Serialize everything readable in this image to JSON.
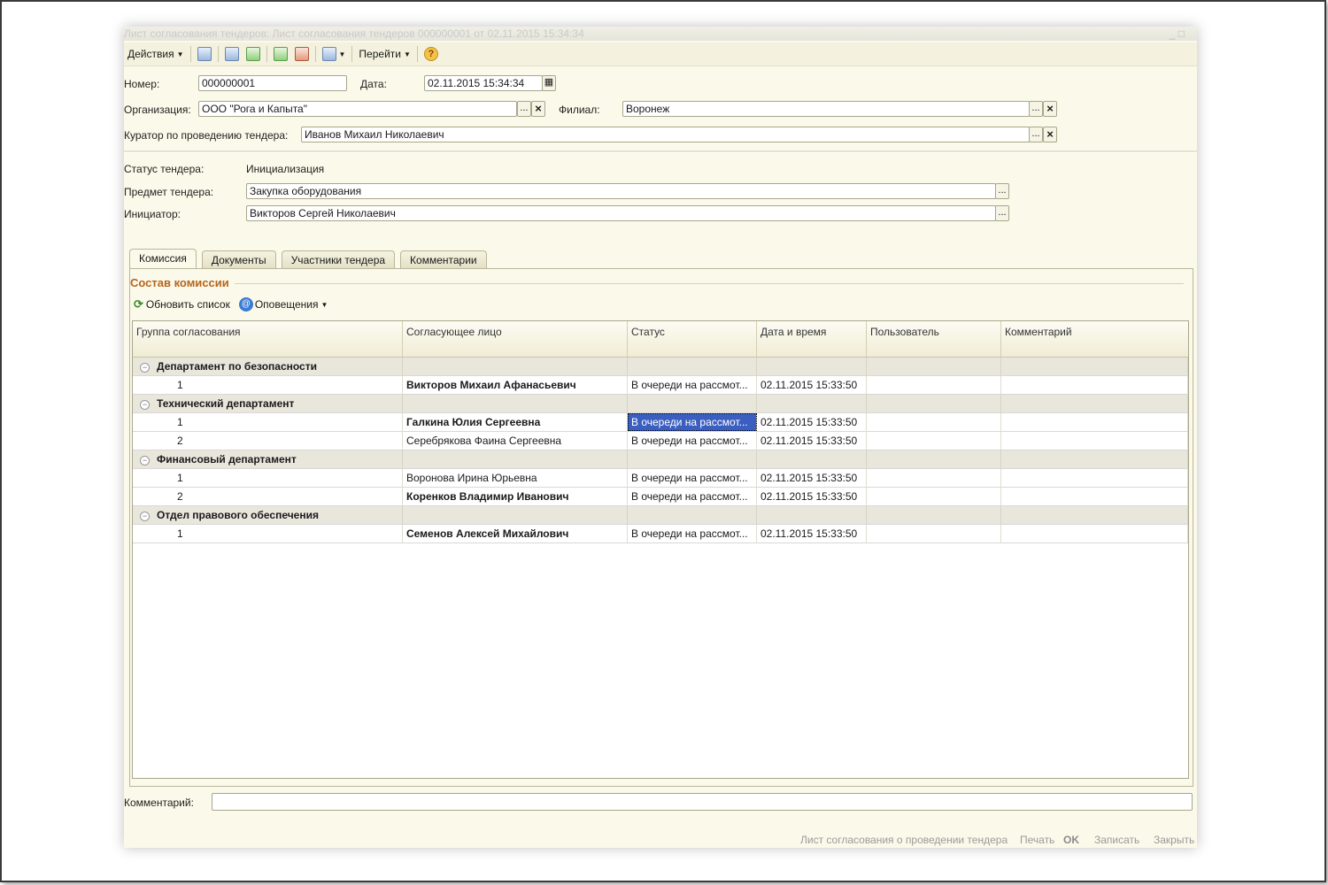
{
  "window": {
    "title": "Лист согласования тендеров: Лист согласования тендеров 000000001 от 02.11.2015 15:34:34",
    "controls": "_ □"
  },
  "toolbar": {
    "actions_label": "Действия",
    "goto_label": "Перейти",
    "help_symbol": "?"
  },
  "form": {
    "number_label": "Номер:",
    "number_value": "000000001",
    "date_label": "Дата:",
    "date_value": "02.11.2015 15:34:34",
    "org_label": "Организация:",
    "org_value": "ООО \"Рога и Капыта\"",
    "branch_label": "Филиал:",
    "branch_value": "Воронеж",
    "curator_label": "Куратор по проведению тендера:",
    "curator_value": "Иванов Михаил Николаевич",
    "status_label": "Статус тендера:",
    "status_value": "Инициализация",
    "subject_label": "Предмет тендера:",
    "subject_value": "Закупка оборудования",
    "initiator_label": "Инициатор:",
    "initiator_value": "Викторов Сергей Николаевич",
    "dots": "...",
    "clear": "×"
  },
  "tabs": [
    {
      "label": "Комиссия"
    },
    {
      "label": "Документы"
    },
    {
      "label": "Участники тендера"
    },
    {
      "label": "Комментарии"
    }
  ],
  "commission": {
    "title": "Состав комиссии",
    "refresh_label": "Обновить список",
    "notify_label": "Оповещения",
    "columns": [
      "Группа согласования",
      "Согласующее лицо",
      "Статус",
      "Дата и время",
      "Пользователь",
      "Комментарий"
    ],
    "groups": [
      {
        "name": "Департамент по безопасности",
        "rows": [
          {
            "n": "1",
            "person": "Викторов Михаил Афанасьевич",
            "status": "В очереди на рассмот...",
            "dt": "02.11.2015 15:33:50"
          }
        ]
      },
      {
        "name": "Технический департамент",
        "rows": [
          {
            "n": "1",
            "person": "Галкина Юлия Сергеевна",
            "status": "В очереди на рассмот...",
            "dt": "02.11.2015 15:33:50"
          },
          {
            "n": "2",
            "person": "Серебрякова Фаина Сергеевна",
            "status": "В очереди на рассмот...",
            "dt": "02.11.2015 15:33:50"
          }
        ]
      },
      {
        "name": "Финансовый департамент",
        "rows": [
          {
            "n": "1",
            "person": "Воронова Ирина Юрьевна",
            "status": "В очереди на рассмот...",
            "dt": "02.11.2015 15:33:50"
          },
          {
            "n": "2",
            "person": "Коренков Владимир Иванович",
            "status": "В очереди на рассмот...",
            "dt": "02.11.2015 15:33:50"
          }
        ]
      },
      {
        "name": "Отдел правового обеспечения",
        "rows": [
          {
            "n": "1",
            "person": "Семенов Алексей Михайлович",
            "status": "В очереди на рассмот...",
            "dt": "02.11.2015 15:33:50"
          }
        ]
      }
    ]
  },
  "footer": {
    "comment_label": "Комментарий:",
    "comment_value": "",
    "print_form_link": "Лист согласования о проведении тендера",
    "print_label": "Печать",
    "ok_label": "OK",
    "save_label": "Записать",
    "close_label": "Закрыть"
  }
}
